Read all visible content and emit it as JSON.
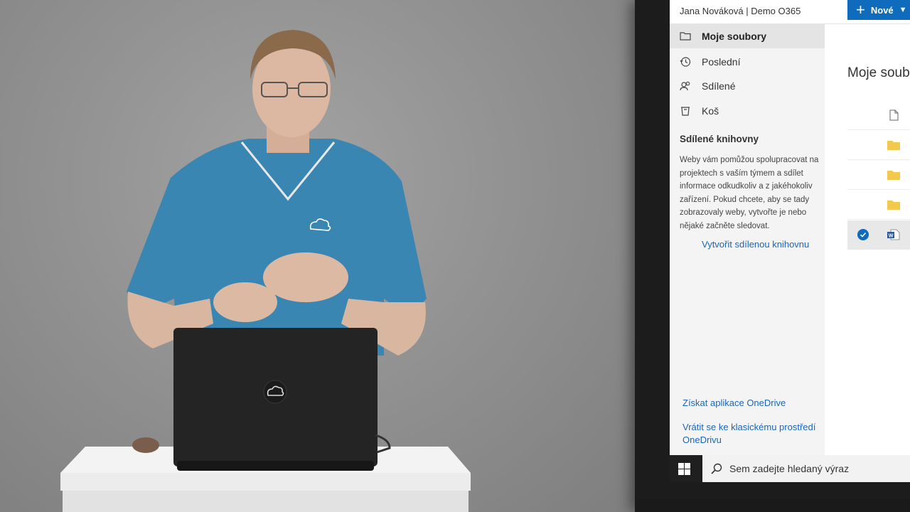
{
  "onedrive": {
    "account": "Jana Nováková | Demo O365",
    "new_button": "Nové",
    "nav": [
      {
        "label": "Moje soubory",
        "icon": "folder-icon",
        "selected": true
      },
      {
        "label": "Poslední",
        "icon": "history-icon",
        "selected": false
      },
      {
        "label": "Sdílené",
        "icon": "people-icon",
        "selected": false
      },
      {
        "label": "Koš",
        "icon": "recycle-bin-icon",
        "selected": false
      }
    ],
    "shared_libraries": {
      "title": "Sdílené knihovny",
      "description": "Weby vám pomůžou spolupracovat na projektech s vaším týmem a sdílet informace odkudkoliv a z jakéhokoliv zařízení. Pokud chcete, aby se tady zobrazovaly weby, vytvořte je nebo nějaké začněte sledovat.",
      "create_link": "Vytvořit sdílenou knihovnu"
    },
    "bottom_links": [
      "Získat aplikace OneDrive",
      "Vrátit se ke klasickému prostředí OneDrivu"
    ],
    "main_title": "Moje soub",
    "files": [
      {
        "icon": "document-icon",
        "selected": false
      },
      {
        "icon": "folder-icon",
        "selected": false
      },
      {
        "icon": "folder-icon",
        "selected": false
      },
      {
        "icon": "folder-icon",
        "selected": false
      },
      {
        "icon": "word-file-icon",
        "selected": true
      }
    ]
  },
  "taskbar": {
    "search_placeholder": "Sem zadejte hledaný výraz"
  },
  "colors": {
    "accent": "#0f6cbd",
    "folder": "#f2c94c",
    "shirt": "#3a86b3"
  }
}
